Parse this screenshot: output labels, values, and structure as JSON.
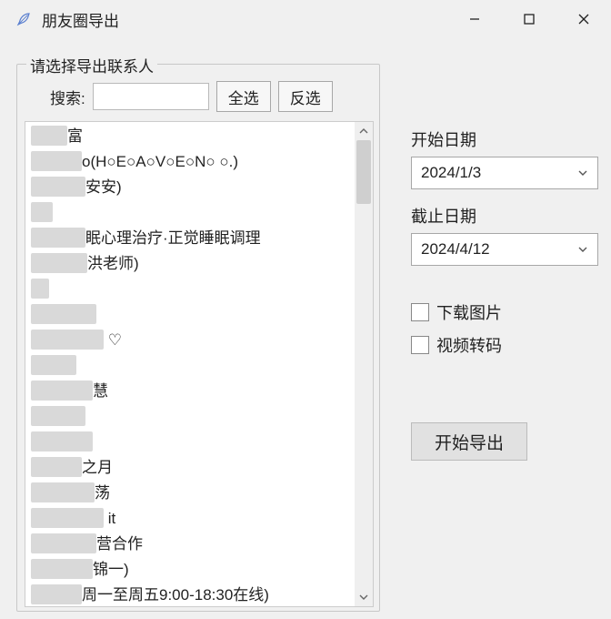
{
  "window": {
    "title": "朋友圈导出"
  },
  "contacts_group": {
    "legend": "请选择导出联系人",
    "search_label": "搜索:",
    "search_value": "",
    "select_all": "全选",
    "invert_selection": "反选",
    "items": [
      {
        "redact_w": 40,
        "suffix": "富"
      },
      {
        "redact_w": 56,
        "suffix": "o(H○E○A○V○E○N○ ○.)"
      },
      {
        "redact_w": 60,
        "suffix": "安安)"
      },
      {
        "redact_w": 24,
        "suffix": ""
      },
      {
        "redact_w": 60,
        "suffix": "眠心理治疗·正觉睡眠调理"
      },
      {
        "redact_w": 62,
        "suffix": "洪老师)"
      },
      {
        "redact_w": 20,
        "suffix": ""
      },
      {
        "redact_w": 72,
        "suffix": ""
      },
      {
        "redact_w": 80,
        "suffix": "  ♡"
      },
      {
        "redact_w": 50,
        "suffix": ""
      },
      {
        "redact_w": 68,
        "suffix": "慧"
      },
      {
        "redact_w": 60,
        "suffix": ""
      },
      {
        "redact_w": 68,
        "suffix": ""
      },
      {
        "redact_w": 56,
        "suffix": "之月"
      },
      {
        "redact_w": 70,
        "suffix": "荡"
      },
      {
        "redact_w": 80,
        "suffix": " it"
      },
      {
        "redact_w": 72,
        "suffix": "营合作"
      },
      {
        "redact_w": 68,
        "suffix": "锦一)"
      },
      {
        "redact_w": 56,
        "suffix": "周一至周五9:00-18:30在线)"
      }
    ]
  },
  "right": {
    "start_date_label": "开始日期",
    "start_date_value": "2024/1/3",
    "end_date_label": "截止日期",
    "end_date_value": "2024/4/12",
    "download_images_label": "下载图片",
    "download_images_checked": false,
    "video_transcode_label": "视频转码",
    "video_transcode_checked": false,
    "export_button": "开始导出"
  }
}
